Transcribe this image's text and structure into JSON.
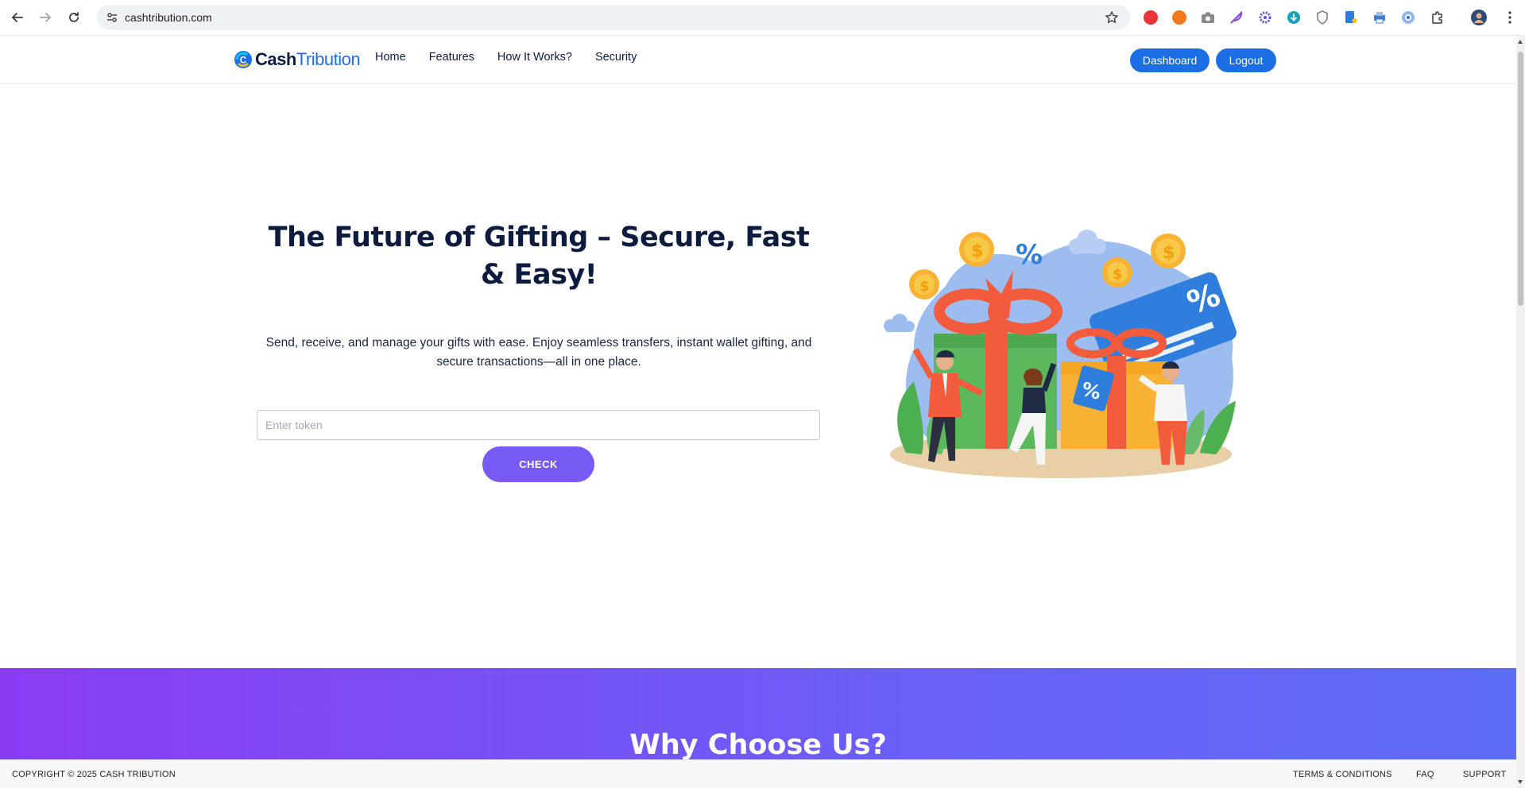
{
  "browser": {
    "url": "cashtribution.com"
  },
  "header": {
    "logo_bold": "Cash",
    "logo_thin": "Tribution",
    "nav": [
      "Home",
      "Features",
      "How It Works?",
      "Security"
    ],
    "dashboard_label": "Dashboard",
    "logout_label": "Logout"
  },
  "hero": {
    "title": "The Future of Gifting – Secure, Fast & Easy!",
    "subtitle": "Send, receive, and manage your gifts with ease. Enjoy seamless transfers, instant wallet gifting, and secure transactions—all in one place.",
    "token_placeholder": "Enter token",
    "token_value": "",
    "check_label": "CHECK"
  },
  "why": {
    "title": "Why Choose Us?"
  },
  "footer": {
    "copyright": "COPYRIGHT © 2025 CASH TRIBUTION",
    "terms": "TERMS & CONDITIONS",
    "faq": "FAQ",
    "support": "SUPPORT"
  },
  "colors": {
    "brand_blue": "#1c6ee5",
    "check_purple": "#7a5af5",
    "gradient_start": "#8a3cf5",
    "gradient_end": "#5e6cf6"
  },
  "icons": {
    "back": "back-arrow-icon",
    "forward": "forward-arrow-icon",
    "reload": "reload-icon",
    "site_info": "site-info-icon",
    "bookmark": "star-icon",
    "extensions": "puzzle-icon",
    "menu": "kebab-menu-icon"
  }
}
